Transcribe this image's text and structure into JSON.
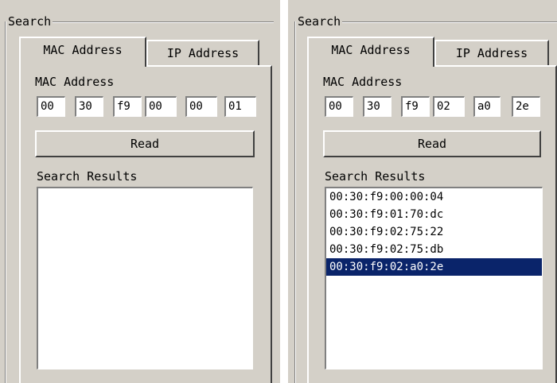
{
  "left": {
    "group_title": "Search",
    "tabs": [
      {
        "label": "MAC Address",
        "active": true
      },
      {
        "label": "IP Address",
        "active": false
      }
    ],
    "mac_label": "MAC Address",
    "octets": [
      "00",
      "30",
      "f9",
      "00",
      "00",
      "01"
    ],
    "read_label": "Read",
    "results_label": "Search Results",
    "results": []
  },
  "right": {
    "group_title": "Search",
    "tabs": [
      {
        "label": "MAC Address",
        "active": true
      },
      {
        "label": "IP Address",
        "active": false
      }
    ],
    "mac_label": "MAC Address",
    "octets": [
      "00",
      "30",
      "f9",
      "02",
      "a0",
      "2e"
    ],
    "read_label": "Read",
    "results_label": "Search Results",
    "results": [
      "00:30:f9:00:00:04",
      "00:30:f9:01:70:dc",
      "00:30:f9:02:75:22",
      "00:30:f9:02:75:db",
      "00:30:f9:02:a0:2e"
    ],
    "selected_index": 4,
    "selection_color": "#0a246a"
  }
}
